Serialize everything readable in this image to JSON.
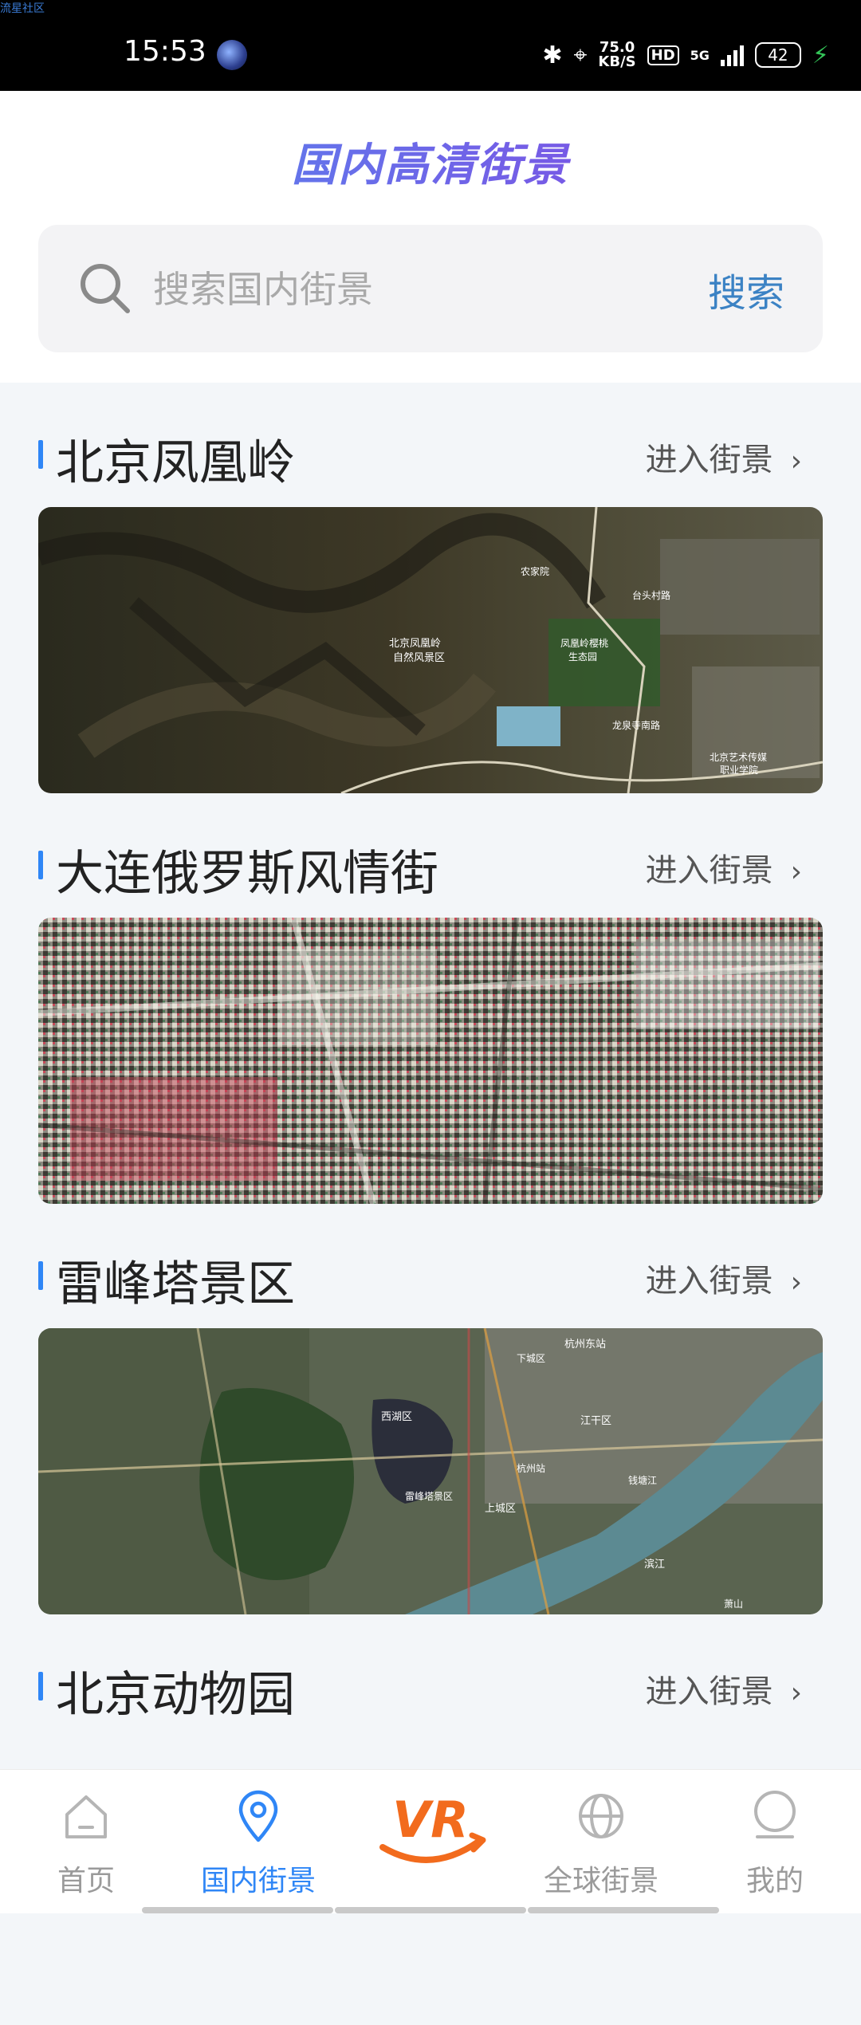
{
  "status_bar": {
    "watermark": "流星社区",
    "time": "15:53",
    "speed_value": "75.0",
    "speed_unit": "KB/S",
    "hd": "HD",
    "network": "5G",
    "battery": "42"
  },
  "header": {
    "title": "国内高清街景"
  },
  "search": {
    "placeholder": "搜索国内街景",
    "button_label": "搜索"
  },
  "sections": [
    {
      "title": "北京凤凰岭",
      "action": "进入街景"
    },
    {
      "title": "大连俄罗斯风情街",
      "action": "进入街景"
    },
    {
      "title": "雷峰塔景区",
      "action": "进入街景"
    },
    {
      "title": "北京动物园",
      "action": "进入街景"
    }
  ],
  "map_labels": {
    "fenghuangling": [
      "北京凤凰岭",
      "自然风景区",
      "凤凰岭樱桃",
      "生态园",
      "农家院",
      "龙泉寺南路",
      "北京艺术传媒",
      "职业学院",
      "台头村路"
    ],
    "leifeng": [
      "杭州东站",
      "西湖区",
      "雷峰塔景区",
      "杭州站",
      "钱塘江",
      "滨江",
      "上城区",
      "江干区",
      "萧山",
      "下城区"
    ]
  },
  "tabbar": {
    "tabs": [
      {
        "label": "首页"
      },
      {
        "label": "国内街景"
      },
      {
        "label": "VR"
      },
      {
        "label": "全球街景"
      },
      {
        "label": "我的"
      }
    ]
  },
  "colors": {
    "accent": "#2f86f6",
    "title_gradient_start": "#4f8ff0",
    "title_gradient_end": "#8b3fe0",
    "vr_orange": "#f26b1d"
  }
}
